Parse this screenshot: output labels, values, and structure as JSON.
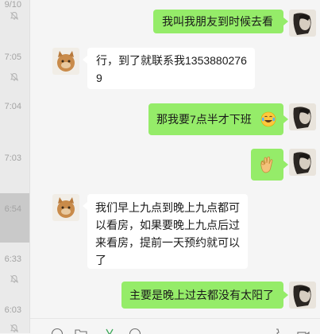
{
  "chat_list": {
    "items": [
      {
        "time": "9/10",
        "muted": true
      },
      {
        "time": "7:05",
        "muted": true
      },
      {
        "time": "7:04",
        "muted": false
      },
      {
        "time": "7:03",
        "muted": false
      },
      {
        "time": "6:54",
        "muted": false,
        "active": true
      },
      {
        "time": "6:33",
        "muted": true
      },
      {
        "time": "6:03",
        "muted": true
      }
    ]
  },
  "messages": [
    {
      "direction": "outgoing",
      "text": "我叫我朋友到时候去看"
    },
    {
      "direction": "incoming",
      "text": "行，到了就联系我13538802769"
    },
    {
      "direction": "outgoing",
      "text": "那我要7点半才下班",
      "emoji": "grinning-tears-emoji"
    },
    {
      "direction": "outgoing",
      "text": "",
      "emoji": "ok-hand-emoji"
    },
    {
      "direction": "incoming",
      "text": "我们早上九点到晚上九点都可以看房，如果要晚上九点后过来看房，提前一天预约就可以了"
    },
    {
      "direction": "outgoing",
      "text": "主要是晚上过去都没有太阳了"
    }
  ],
  "toolbar": {
    "icons": [
      "emoji-icon",
      "folder-icon",
      "scissors-icon",
      "chat-history-icon",
      "phone-icon",
      "video-icon"
    ]
  }
}
